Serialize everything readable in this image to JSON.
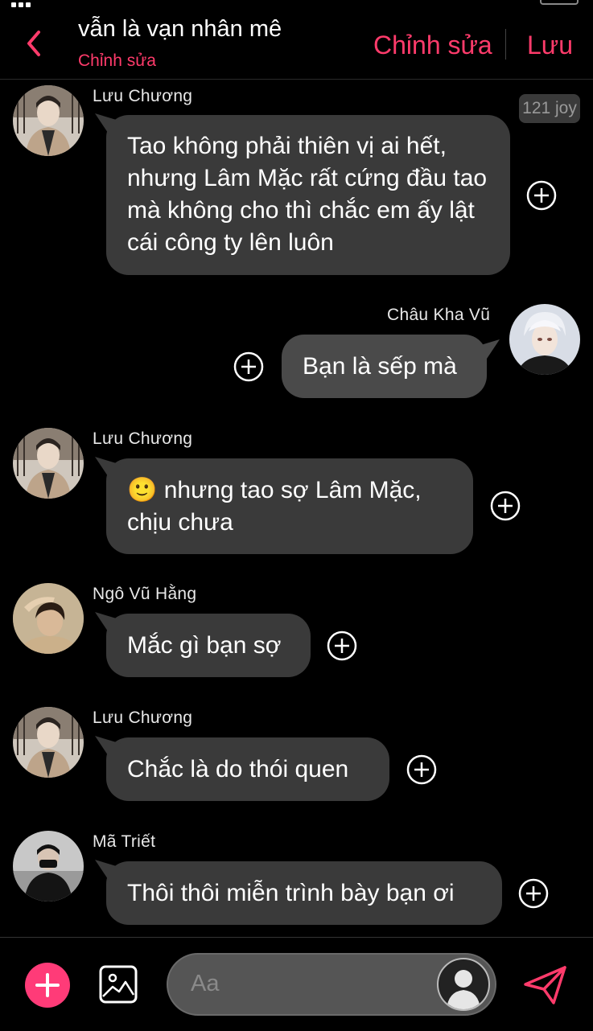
{
  "header": {
    "title": "vẫn là vạn nhân mê",
    "subtitle": "Chỉnh sửa",
    "edit_label": "Chỉnh sửa",
    "save_label": "Lưu"
  },
  "badge": {
    "text": "121 joy"
  },
  "messages": [
    {
      "sender": "Lưu Chương",
      "side": "left",
      "text": "Tao không phải thiên vị ai hết, nhưng Lâm Mặc rất cứng đầu tao mà không cho thì chắc em ấy lật cái công ty lên luôn"
    },
    {
      "sender": "Châu Kha Vũ",
      "side": "right",
      "text": "Bạn là sếp mà"
    },
    {
      "sender": "Lưu Chương",
      "side": "left",
      "emoji": "🙂",
      "text": "nhưng tao sợ Lâm Mặc, chịu chưa"
    },
    {
      "sender": "Ngô Vũ Hằng",
      "side": "left",
      "text": "Mắc gì bạn sợ"
    },
    {
      "sender": "Lưu Chương",
      "side": "left",
      "text": "Chắc là do thói quen"
    },
    {
      "sender": "Mã Triết",
      "side": "left",
      "text": "Thôi thôi miễn trình bày bạn ơi"
    }
  ],
  "composer": {
    "placeholder": "Aa"
  },
  "colors": {
    "accent": "#ff3b6b",
    "bubble": "#3a3a3a",
    "background": "#000000"
  },
  "icons": [
    "chevron-left-icon",
    "plus-circle-icon",
    "add-icon",
    "image-icon",
    "send-icon"
  ]
}
